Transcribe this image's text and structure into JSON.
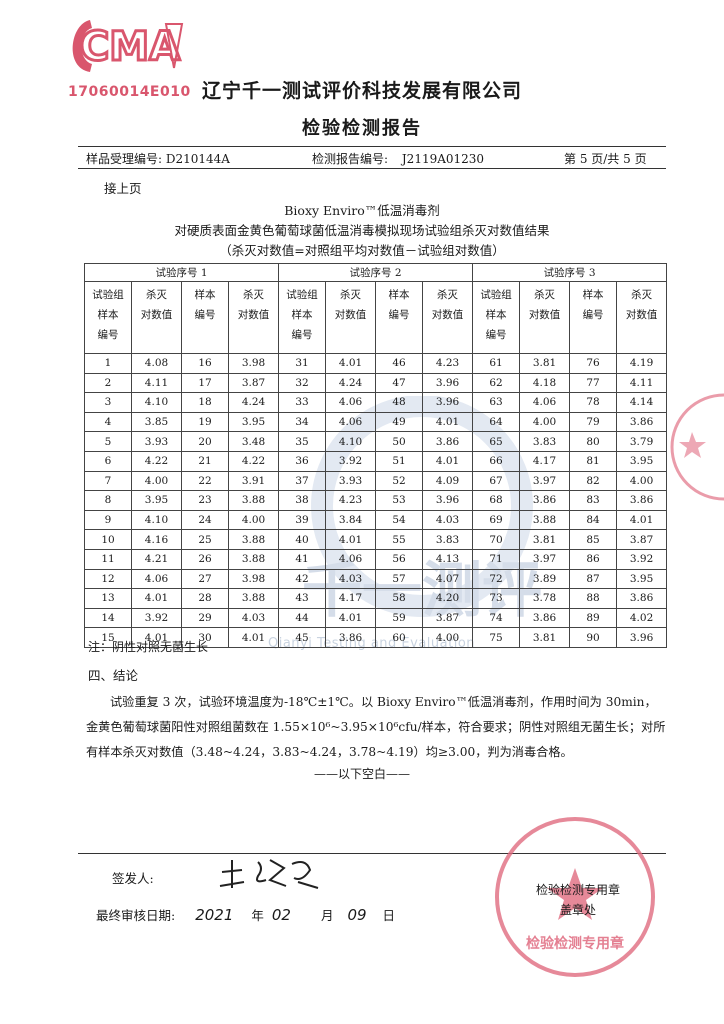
{
  "stamp": {
    "code": "17060014E010",
    "letters": "CMA"
  },
  "header": {
    "company": "辽宁千一测试评价科技发展有限公司",
    "title": "检验检测报告",
    "sample_label": "样品受理编号:",
    "sample_no": "D210144A",
    "report_label": "检测报告编号:",
    "report_no": "J2119A01230",
    "page": "第 5 页/共 5 页"
  },
  "continued": "接上页",
  "table_title": {
    "line1": "Bioxy Enviro™低温消毒剂",
    "line2": "对硬质表面金黄色葡萄球菌低温消毒模拟现场试验组杀灭对数值结果",
    "line3": "（杀灭对数值=对照组平均对数值－试验组对数值）"
  },
  "table": {
    "groups": [
      "试验序号 1",
      "试验序号 2",
      "试验序号 3"
    ],
    "col_a": [
      "试验组",
      "样本",
      "编号"
    ],
    "col_b": [
      "杀灭",
      "对数值"
    ],
    "col_c": [
      "样本",
      "编号"
    ],
    "col_d": [
      "杀灭",
      "对数值"
    ],
    "rows": [
      [
        "1",
        "4.08",
        "16",
        "3.98",
        "31",
        "4.01",
        "46",
        "4.23",
        "61",
        "3.81",
        "76",
        "4.19"
      ],
      [
        "2",
        "4.11",
        "17",
        "3.87",
        "32",
        "4.24",
        "47",
        "3.96",
        "62",
        "4.18",
        "77",
        "4.11"
      ],
      [
        "3",
        "4.10",
        "18",
        "4.24",
        "33",
        "4.06",
        "48",
        "3.96",
        "63",
        "4.06",
        "78",
        "4.14"
      ],
      [
        "4",
        "3.85",
        "19",
        "3.95",
        "34",
        "4.06",
        "49",
        "4.01",
        "64",
        "4.00",
        "79",
        "3.86"
      ],
      [
        "5",
        "3.93",
        "20",
        "3.48",
        "35",
        "4.10",
        "50",
        "3.86",
        "65",
        "3.83",
        "80",
        "3.79"
      ],
      [
        "6",
        "4.22",
        "21",
        "4.22",
        "36",
        "3.92",
        "51",
        "4.01",
        "66",
        "4.17",
        "81",
        "3.95"
      ],
      [
        "7",
        "4.00",
        "22",
        "3.91",
        "37",
        "3.93",
        "52",
        "4.09",
        "67",
        "3.97",
        "82",
        "4.00"
      ],
      [
        "8",
        "3.95",
        "23",
        "3.88",
        "38",
        "4.23",
        "53",
        "3.96",
        "68",
        "3.86",
        "83",
        "3.86"
      ],
      [
        "9",
        "4.10",
        "24",
        "4.00",
        "39",
        "3.84",
        "54",
        "4.03",
        "69",
        "3.88",
        "84",
        "4.01"
      ],
      [
        "10",
        "4.16",
        "25",
        "3.88",
        "40",
        "4.01",
        "55",
        "3.83",
        "70",
        "3.81",
        "85",
        "3.87"
      ],
      [
        "11",
        "4.21",
        "26",
        "3.88",
        "41",
        "4.06",
        "56",
        "4.13",
        "71",
        "3.97",
        "86",
        "3.92"
      ],
      [
        "12",
        "4.06",
        "27",
        "3.98",
        "42",
        "4.03",
        "57",
        "4.07",
        "72",
        "3.89",
        "87",
        "3.95"
      ],
      [
        "13",
        "4.01",
        "28",
        "3.88",
        "43",
        "4.17",
        "58",
        "4.20",
        "73",
        "3.78",
        "88",
        "3.86"
      ],
      [
        "14",
        "3.92",
        "29",
        "4.03",
        "44",
        "4.01",
        "59",
        "3.87",
        "74",
        "3.86",
        "89",
        "4.02"
      ],
      [
        "15",
        "4.01",
        "30",
        "4.01",
        "45",
        "3.86",
        "60",
        "4.00",
        "75",
        "3.81",
        "90",
        "3.96"
      ]
    ]
  },
  "note": "注：阴性对照无菌生长",
  "conclusion": {
    "heading": "四、结论",
    "text": "试验重复 3 次，试验环境温度为-18℃±1℃。以 Bioxy Enviro™低温消毒剂，作用时间为 30min，金黄色葡萄球菌阳性对照组菌数在 1.55×10⁶~3.95×10⁶cfu/样本，符合要求；阴性对照组无菌生长；对所有样本杀灭对数值（3.48~4.24，3.83~4.24，3.78~4.19）均≥3.00，判为消毒合格。"
  },
  "blank_line": "——以下空白——",
  "footer": {
    "signer_label": "签发人:",
    "date_label": "最终审核日期:",
    "year": "2021",
    "year_unit": "年",
    "month": "02",
    "month_unit": "月",
    "day": "09",
    "day_unit": "日",
    "stamp_label1": "检验检测专用章",
    "stamp_label2": "盖章处"
  },
  "watermark": {
    "cn": "千一测评",
    "en": "Qianyi Testing and Evaluation"
  },
  "colors": {
    "seal_red": "#d9566d",
    "watermark_blue": "#dbe3ee"
  }
}
